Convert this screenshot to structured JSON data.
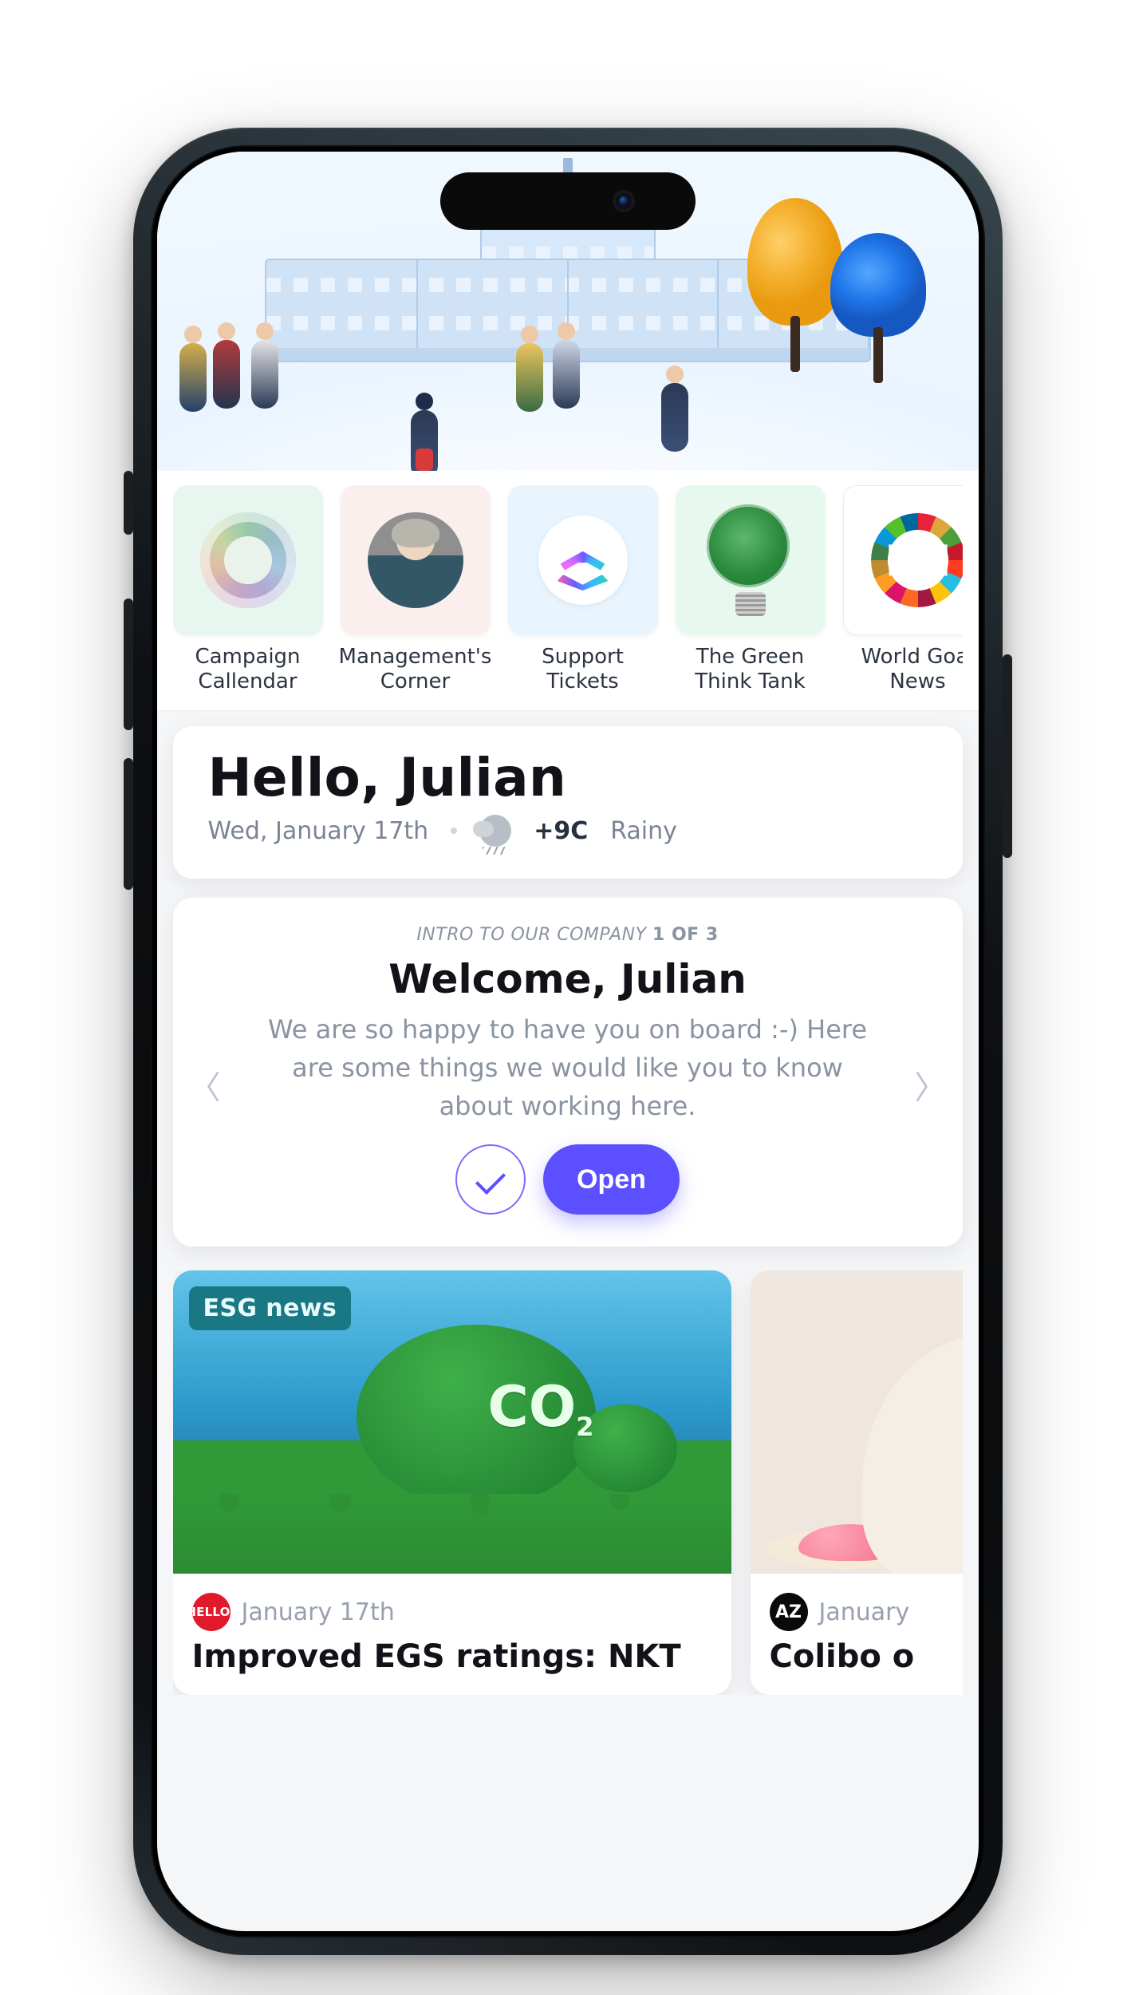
{
  "shortcuts": [
    {
      "label": "Campaign Callendar"
    },
    {
      "label": "Management's Corner"
    },
    {
      "label": "Support Tickets"
    },
    {
      "label": "The Green Think Tank"
    },
    {
      "label": "World Goal News"
    }
  ],
  "greeting": {
    "hello": "Hello, Julian",
    "date": "Wed, January 17th",
    "temp": "+9C",
    "condition": "Rainy"
  },
  "intro": {
    "eyebrow": "INTRO TO OUR COMPANY",
    "progress": "1 OF 3",
    "title": "Welcome, Julian",
    "body": "We are so happy to have you on board :-) Here are some things we would like you to know about working here.",
    "open": "Open"
  },
  "news": [
    {
      "pill": "ESG news",
      "badge": "HELLO!",
      "date": "January 17th",
      "headline": "Improved EGS ratings: NKT"
    },
    {
      "badge": "AZ",
      "date": "January",
      "headline": "Colibo o"
    }
  ]
}
